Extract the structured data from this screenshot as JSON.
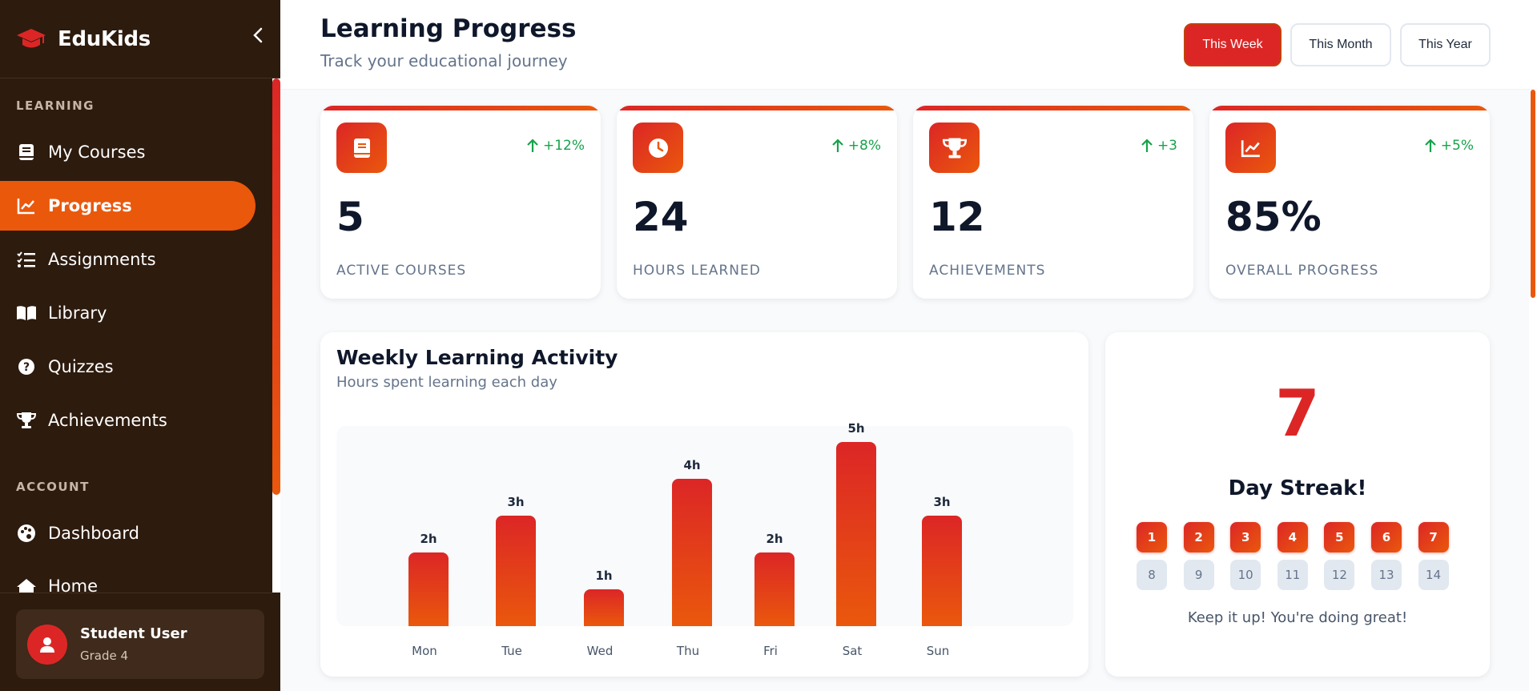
{
  "brand": {
    "name": "EduKids"
  },
  "sidebar": {
    "sections": [
      {
        "label": "LEARNING"
      },
      {
        "label": "ACCOUNT"
      }
    ],
    "items": [
      {
        "label": "My Courses",
        "icon": "book-icon"
      },
      {
        "label": "Progress",
        "icon": "chart-line-icon",
        "active": true
      },
      {
        "label": "Assignments",
        "icon": "task-list-icon"
      },
      {
        "label": "Library",
        "icon": "open-book-icon"
      },
      {
        "label": "Quizzes",
        "icon": "question-icon"
      },
      {
        "label": "Achievements",
        "icon": "trophy-icon"
      },
      {
        "label": "Dashboard",
        "icon": "palette-icon"
      },
      {
        "label": "Home",
        "icon": "home-icon"
      }
    ],
    "user": {
      "name": "Student User",
      "grade": "Grade 4"
    }
  },
  "header": {
    "title": "Learning Progress",
    "subtitle": "Track your educational journey",
    "ranges": [
      {
        "label": "This Week",
        "active": true
      },
      {
        "label": "This Month"
      },
      {
        "label": "This Year"
      }
    ]
  },
  "stats": [
    {
      "icon": "book-icon",
      "change": "+12%",
      "value": "5",
      "label": "ACTIVE COURSES"
    },
    {
      "icon": "clock-icon",
      "change": "+8%",
      "value": "24",
      "label": "HOURS LEARNED"
    },
    {
      "icon": "trophy-icon",
      "change": "+3",
      "value": "12",
      "label": "ACHIEVEMENTS"
    },
    {
      "icon": "chart-line-icon",
      "change": "+5%",
      "value": "85%",
      "label": "OVERALL PROGRESS"
    }
  ],
  "activity": {
    "title": "Weekly Learning Activity",
    "subtitle": "Hours spent learning each day"
  },
  "chart_data": {
    "type": "bar",
    "categories": [
      "Mon",
      "Tue",
      "Wed",
      "Thu",
      "Fri",
      "Sat",
      "Sun"
    ],
    "values": [
      2,
      3,
      1,
      4,
      2,
      5,
      3
    ],
    "data_labels": [
      "2h",
      "3h",
      "1h",
      "4h",
      "2h",
      "5h",
      "3h"
    ],
    "ylim": [
      0,
      5
    ],
    "grid": false
  },
  "streak": {
    "count": "7",
    "label": "Day Streak!",
    "days": [
      "1",
      "2",
      "3",
      "4",
      "5",
      "6",
      "7",
      "8",
      "9",
      "10",
      "11",
      "12",
      "13",
      "14"
    ],
    "completed": 7,
    "message": "Keep it up! You're doing great!"
  },
  "colors": {
    "accent": "#ea580c",
    "primary": "#dc2626",
    "sidebar_bg": "#2d1b0e",
    "positive": "#16a34a"
  }
}
